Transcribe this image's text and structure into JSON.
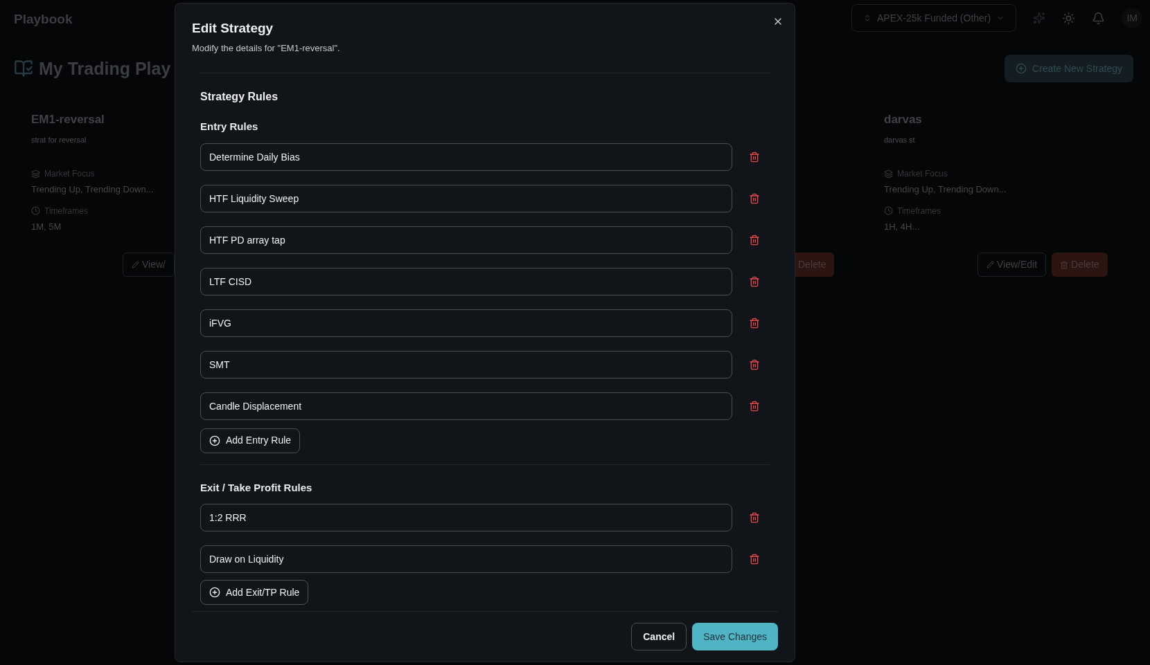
{
  "header": {
    "app_title": "Playbook",
    "account_selector": "APEX-25k Funded (Other)",
    "avatar": "IM"
  },
  "page": {
    "title": "My Trading Play",
    "create_button": "Create New Strategy"
  },
  "cards": [
    {
      "name": "EM1-reversal",
      "description": "strat for reversal",
      "market_focus_label": "Market Focus",
      "market_focus": "Trending Up, Trending Down...",
      "timeframes_label": "Timeframes",
      "timeframes": "1M, 5M",
      "view_button": "View/"
    },
    {
      "delete_button": "Delete"
    },
    {
      "name": "darvas",
      "description": "darvas st",
      "market_focus_label": "Market Focus",
      "market_focus": "Trending Up, Trending Down...",
      "timeframes_label": "Timeframes",
      "timeframes": "1H, 4H...",
      "view_button": "View/Edit",
      "delete_button": "Delete"
    }
  ],
  "dialog": {
    "title": "Edit Strategy",
    "subtitle": "Modify the details for \"EM1-reversal\".",
    "section_title": "Strategy Rules",
    "groups": [
      {
        "title": "Entry Rules",
        "rules": [
          "Determine Daily Bias",
          "HTF Liquidity Sweep",
          "HTF PD array tap",
          "LTF CISD",
          "iFVG",
          "SMT",
          "Candle Displacement"
        ],
        "add_button": "Add Entry Rule"
      },
      {
        "title": "Exit / Take Profit Rules",
        "rules": [
          "1:2 RRR",
          "Draw on Liquidity"
        ],
        "add_button": "Add Exit/TP Rule"
      }
    ],
    "cancel_button": "Cancel",
    "save_button": "Save Changes"
  }
}
